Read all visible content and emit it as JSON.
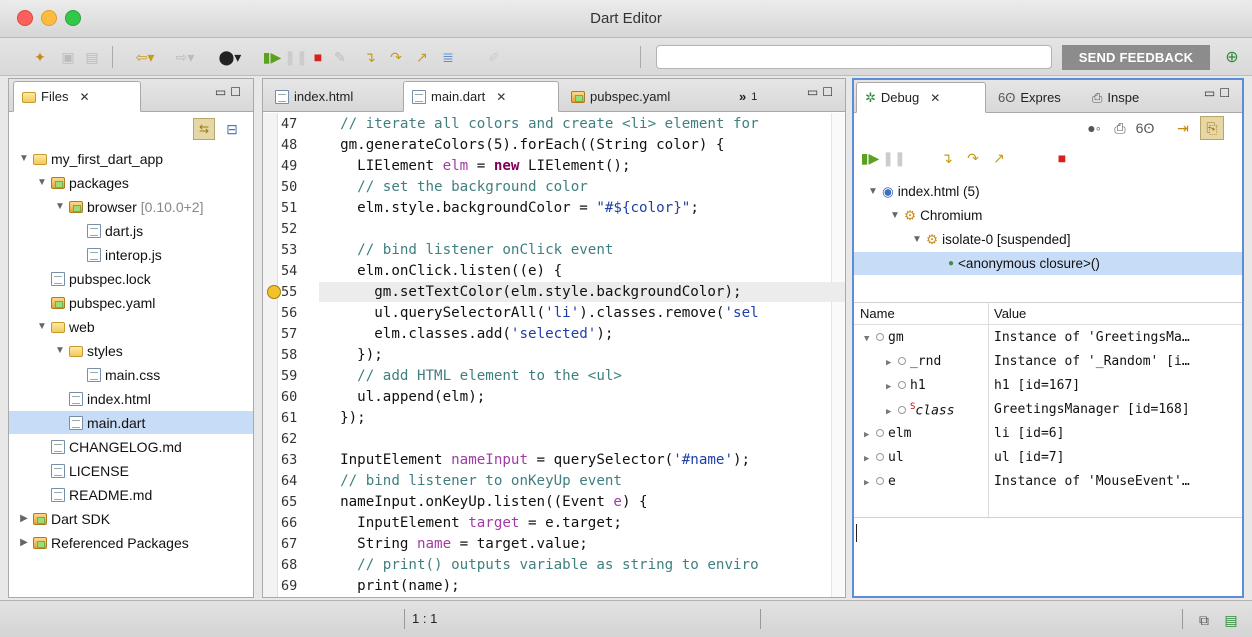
{
  "window": {
    "title": "Dart Editor"
  },
  "toolbar": {
    "feedback_label": "SEND FEEDBACK",
    "search_placeholder": ""
  },
  "files": {
    "tab_label": "Files",
    "tree": [
      {
        "label": "my_first_dart_app",
        "icon": "folder-icon",
        "expanded": true,
        "depth": 0
      },
      {
        "label": "packages",
        "icon": "package-folder-icon",
        "expanded": true,
        "depth": 1
      },
      {
        "label": "browser",
        "suffix": "[0.10.0+2]",
        "icon": "library-icon",
        "expanded": true,
        "depth": 2
      },
      {
        "label": "dart.js",
        "icon": "file-icon",
        "depth": 3
      },
      {
        "label": "interop.js",
        "icon": "file-icon",
        "depth": 3
      },
      {
        "label": "pubspec.lock",
        "icon": "file-icon",
        "depth": 1
      },
      {
        "label": "pubspec.yaml",
        "icon": "package-file-icon",
        "depth": 1
      },
      {
        "label": "web",
        "icon": "folder-icon",
        "expanded": true,
        "depth": 1
      },
      {
        "label": "styles",
        "icon": "folder-icon",
        "expanded": true,
        "depth": 2
      },
      {
        "label": "main.css",
        "icon": "file-icon",
        "depth": 3
      },
      {
        "label": "index.html",
        "icon": "file-icon",
        "depth": 2
      },
      {
        "label": "main.dart",
        "icon": "dart-file-icon",
        "depth": 2,
        "selected": true
      },
      {
        "label": "CHANGELOG.md",
        "icon": "file-icon",
        "depth": 1
      },
      {
        "label": "LICENSE",
        "icon": "file-icon",
        "depth": 1
      },
      {
        "label": "README.md",
        "icon": "file-icon",
        "depth": 1
      },
      {
        "label": "Dart SDK",
        "icon": "package-folder-icon",
        "collapsed": true,
        "depth": 0
      },
      {
        "label": "Referenced Packages",
        "icon": "package-folder-icon",
        "collapsed": true,
        "depth": 0
      }
    ]
  },
  "editor": {
    "tabs": [
      {
        "label": "index.html",
        "active": false
      },
      {
        "label": "main.dart",
        "active": true
      },
      {
        "label": "pubspec.yaml",
        "active": false
      }
    ],
    "overflow_label": "»",
    "overflow_count": "1",
    "current_line": "55",
    "lines": [
      {
        "n": "47",
        "html": "  <span class=\"cm\">// iterate all colors and create &lt;li&gt; element for</span>"
      },
      {
        "n": "48",
        "html": "  gm.generateColors(5).forEach((String color) {"
      },
      {
        "n": "49",
        "html": "    LIElement <span class=\"vr\">elm</span> = <span class=\"kw\">new</span> LIElement();"
      },
      {
        "n": "50",
        "html": "    <span class=\"cm\">// set the background color</span>"
      },
      {
        "n": "51",
        "html": "    elm.style.backgroundColor = <span class=\"st\">\"#${color}\"</span>;"
      },
      {
        "n": "52",
        "html": ""
      },
      {
        "n": "53",
        "html": "    <span class=\"cm\">// bind listener onClick event</span>"
      },
      {
        "n": "54",
        "html": "    elm.onClick.listen((e) {"
      },
      {
        "n": "55",
        "html": "      gm.setTextColor(elm.style.backgroundColor);"
      },
      {
        "n": "56",
        "html": "      ul.querySelectorAll(<span class=\"st\">'li'</span>).classes.remove(<span class=\"st\">'sel</span>"
      },
      {
        "n": "57",
        "html": "      elm.classes.add(<span class=\"st\">'selected'</span>);"
      },
      {
        "n": "58",
        "html": "    });"
      },
      {
        "n": "59",
        "html": "    <span class=\"cm\">// add HTML element to the &lt;ul&gt;</span>"
      },
      {
        "n": "60",
        "html": "    ul.append(elm);"
      },
      {
        "n": "61",
        "html": "  });"
      },
      {
        "n": "62",
        "html": ""
      },
      {
        "n": "63",
        "html": "  InputElement <span class=\"vr\">nameInput</span> = querySelector(<span class=\"st\">'#name'</span>);"
      },
      {
        "n": "64",
        "html": "  <span class=\"cm\">// bind listener to onKeyUp event</span>"
      },
      {
        "n": "65",
        "html": "  nameInput.onKeyUp.listen((Event <span class=\"vr\">e</span>) {"
      },
      {
        "n": "66",
        "html": "    InputElement <span class=\"vr\">target</span> = e.target;"
      },
      {
        "n": "67",
        "html": "    String <span class=\"vr\">name</span> = target.value;"
      },
      {
        "n": "68",
        "html": "    <span class=\"cm\">// print() outputs variable as string to enviro</span>"
      },
      {
        "n": "69",
        "html": "    print(name);"
      }
    ]
  },
  "debug": {
    "tabs": [
      {
        "label": "Debug",
        "active": true
      },
      {
        "label": "Expres",
        "active": false
      },
      {
        "label": "Inspe",
        "active": false
      }
    ],
    "tree": [
      {
        "label": "index.html (5)",
        "depth": 0
      },
      {
        "label": "Chromium",
        "depth": 1
      },
      {
        "label": "isolate-0 [suspended]",
        "depth": 2
      },
      {
        "label": "<anonymous closure>()",
        "depth": 3,
        "selected": true
      }
    ],
    "variables": {
      "headers": {
        "name": "Name",
        "value": "Value"
      },
      "rows": [
        {
          "name": "gm",
          "value": "Instance of 'GreetingsMa…",
          "expanded": true,
          "depth": 0
        },
        {
          "name": "_rnd",
          "value": "Instance of '_Random' [i…",
          "depth": 1
        },
        {
          "name": "h1",
          "value": "h1 [id=167]",
          "depth": 1
        },
        {
          "name": "class",
          "value": "GreetingsManager [id=168]",
          "depth": 1,
          "static": true
        },
        {
          "name": "elm",
          "value": "li [id=6]",
          "depth": 0
        },
        {
          "name": "ul",
          "value": "ul [id=7]",
          "depth": 0
        },
        {
          "name": "e",
          "value": "Instance of 'MouseEvent'…",
          "depth": 0
        }
      ]
    }
  },
  "status": {
    "position": "1 : 1"
  }
}
